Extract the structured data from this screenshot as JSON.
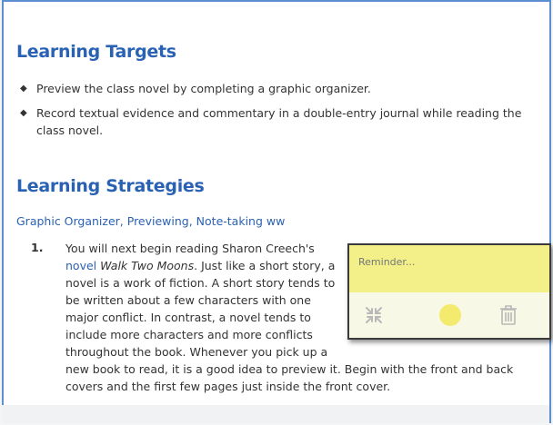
{
  "sections": {
    "targets_heading": "Learning Targets",
    "targets": [
      {
        "lines": [
          "Preview the class novel by completing a graphic organizer."
        ]
      },
      {
        "lines": [
          "Record textual evidence and commentary in a double-entry journal while reading the",
          "class novel."
        ]
      }
    ],
    "strategies_heading": "Learning Strategies",
    "strategies_list": "Graphic Organizer, Previewing, Note-taking ww"
  },
  "item1": {
    "number": "1.",
    "line1": "You will next begin reading Sharon Creech's",
    "line2_link": "novel",
    "line2_title": "Walk Two Moons",
    "line2_rest": ". Just like a short story, a",
    "line3": "novel is a work of fiction. A short story tends to",
    "line4": "be written about a few characters with one",
    "line5": "major conflict. In contrast, a novel tends to",
    "line6": "include more characters and more conflicts",
    "line7": "throughout the book. Whenever you pick up a",
    "line8": "new book to read, it is a good idea to preview it. Begin with the front and back",
    "line9": "covers and the first few pages just inside the front cover."
  },
  "reminder": {
    "placeholder": "Reminder...",
    "icons": [
      "collapse-icon",
      "color-dot-icon",
      "trash-icon"
    ],
    "accent": "#f3f08a"
  }
}
